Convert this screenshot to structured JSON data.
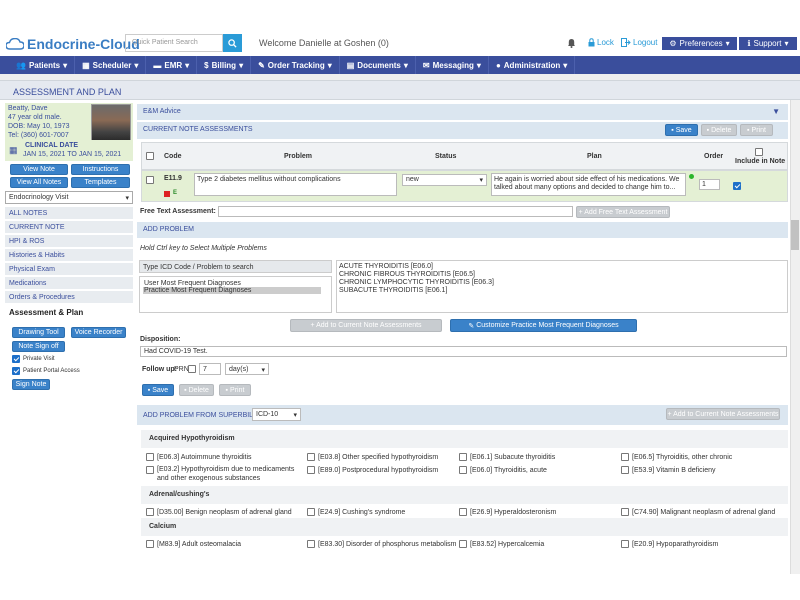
{
  "header": {
    "logo_text": "Endocrine-Cloud",
    "search_placeholder": "Quick Patient Search",
    "welcome": "Welcome Danielle at Goshen (0)",
    "lock": "Lock",
    "logout": "Logout",
    "preferences": "Preferences",
    "support": "Support"
  },
  "nav": [
    "Patients",
    "Scheduler",
    "EMR",
    "Billing",
    "Order Tracking",
    "Documents",
    "Messaging",
    "Administration"
  ],
  "page_title": "ASSESSMENT AND PLAN",
  "patient": {
    "name": "Beatty, Dave",
    "age_sex": "47 year old male.",
    "dob": "DOB: May 10, 1973",
    "tel": "Tel: (360) 601-7007",
    "clinical_label": "CLINICAL DATE",
    "clinical_range": "JAN 15, 2021 TO JAN 15, 2021"
  },
  "side_buttons": {
    "view_note": "View Note",
    "instructions": "Instructions",
    "view_all": "View All Notes",
    "templates": "Templates"
  },
  "visit_select": "Endocrinology Visit",
  "side_links": [
    "ALL NOTES",
    "CURRENT NOTE",
    "HPI & ROS",
    "Histories & Habits",
    "Physical Exam",
    "Medications",
    "Orders & Procedures"
  ],
  "side_active": "Assessment & Plan",
  "side_actions": {
    "drawing": "Drawing Tool",
    "voice": "Voice Recorder",
    "signoff": "Note Sign off",
    "private": "Private Visit",
    "portal": "Patient Portal Access",
    "sign": "Sign Note"
  },
  "em_advice": "E&M Advice",
  "current": {
    "title": "CURRENT NOTE ASSESSMENTS",
    "save": "Save",
    "delete": "Delete",
    "print": "Print",
    "cols": {
      "code": "Code",
      "problem": "Problem",
      "status": "Status",
      "plan": "Plan",
      "order": "Order",
      "include": "Include in Note"
    },
    "row": {
      "code": "E11.9",
      "problem": "Type 2 diabetes mellitus without complications",
      "status": "new",
      "plan": "He again is worried about side effect of his medications. We talked about many options and decided to change him to...",
      "order": "1",
      "tag_e": "E"
    }
  },
  "free_text": {
    "label": "Free Text Assessment:",
    "button": "+ Add Free Text Assessment"
  },
  "add_problem": {
    "title": "ADD PROBLEM",
    "hint": "Hold Ctrl key to Select Multiple Problems",
    "search_placeholder": "Type ICD Code / Problem to search",
    "list_left": [
      "User Most Frequent Diagnoses",
      "Practice Most Frequent Diagnoses"
    ],
    "list_right": [
      "ACUTE THYROIDITIS [E06.0]",
      "CHRONIC FIBROUS THYROIDITIS [E06.5]",
      "CHRONIC LYMPHOCYTIC THYROIDITIS [E06.3]",
      "SUBACUTE THYROIDITIS [E06.1]"
    ],
    "add_btn": "+ Add to Current Note Assessments",
    "customize_btn": "Customize Practice Most Frequent Diagnoses"
  },
  "disposition": {
    "label": "Disposition:",
    "value": "Had COVID-19 Test.",
    "follow_label": "Follow up:",
    "prn": "PRN",
    "num": "7",
    "unit": "day(s)"
  },
  "bottom_buttons": {
    "save": "Save",
    "delete": "Delete",
    "print": "Print"
  },
  "superbill": {
    "title": "ADD PROBLEM FROM SUPERBILL",
    "code_type": "ICD-10",
    "add_btn": "+ Add to Current Note Assessments",
    "groups": [
      {
        "name": "Acquired Hypothyroidism",
        "rows": [
          [
            "[E06.3] Autoimmune thyroiditis",
            "[E03.8] Other specified hypothyroidism",
            "[E06.1] Subacute thyroiditis",
            "[E06.5] Thyroiditis, other chronic"
          ],
          [
            "[E03.2] Hypothyroidism due to medicaments and other exogenous substances",
            "[E89.0] Postprocedural hypothyroidism",
            "[E06.0] Thyroiditis, acute",
            "[E53.9] Vitamin B deficieny"
          ]
        ]
      },
      {
        "name": "Adrenal/cushing's",
        "rows": [
          [
            "[D35.00] Benign neoplasm of adrenal gland",
            "[E24.9] Cushing's syndrome",
            "[E26.9] Hyperaldosteronism",
            "[C74.90] Malignant neoplasm of adrenal gland"
          ]
        ]
      },
      {
        "name": "Calcium",
        "rows": [
          [
            "[M83.9] Adult osteomalacia",
            "[E83.30] Disorder of phosphorus metabolism",
            "[E83.52] Hypercalcemia",
            "[E20.9] Hypoparathyroidism"
          ]
        ]
      }
    ]
  }
}
